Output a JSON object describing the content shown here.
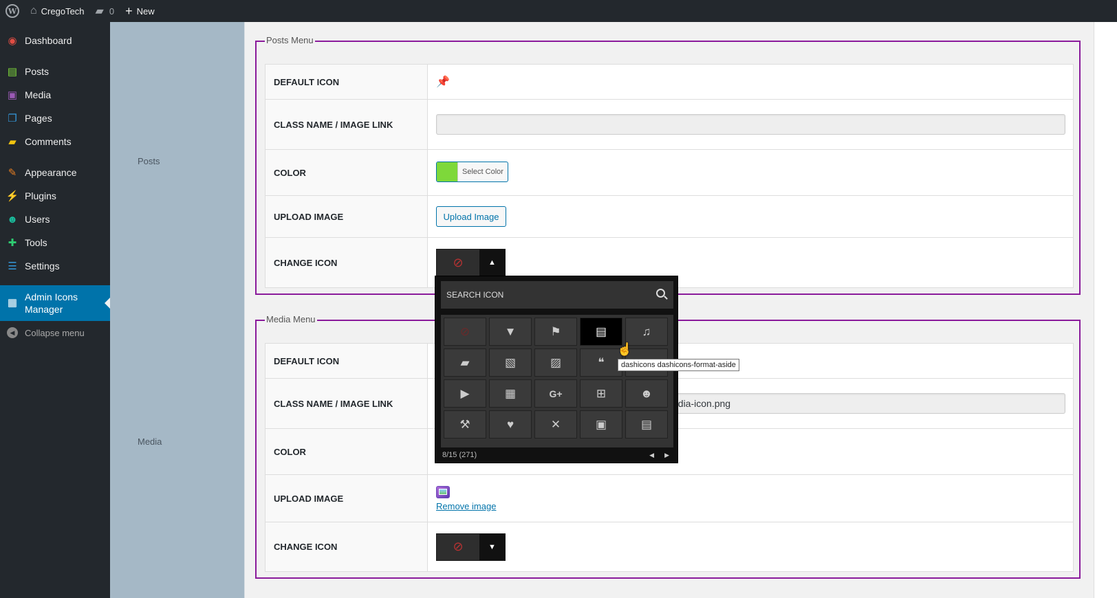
{
  "adminbar": {
    "site_name": "CregoTech",
    "comments_count": "0",
    "new_label": "New"
  },
  "sidebar": {
    "items": [
      {
        "label": "Dashboard",
        "icon": "dashboard-icon",
        "color": "#e14d43"
      },
      {
        "label": "Posts",
        "icon": "posts-icon",
        "color": "#7ed83a"
      },
      {
        "label": "Media",
        "icon": "media-icon",
        "color": "#9b59b6"
      },
      {
        "label": "Pages",
        "icon": "pages-icon",
        "color": "#3498db"
      },
      {
        "label": "Comments",
        "icon": "comments-icon",
        "color": "#f1c40f"
      },
      {
        "label": "Appearance",
        "icon": "appearance-icon",
        "color": "#e67e22"
      },
      {
        "label": "Plugins",
        "icon": "plugins-icon",
        "color": "#e67e22"
      },
      {
        "label": "Users",
        "icon": "users-icon",
        "color": "#1abc9c"
      },
      {
        "label": "Tools",
        "icon": "tools-icon",
        "color": "#2ecc71"
      },
      {
        "label": "Settings",
        "icon": "settings-icon",
        "color": "#3498db"
      },
      {
        "label": "Admin Icons Manager",
        "icon": "admin-icons-manager-icon",
        "color": "#ffffff"
      },
      {
        "label": "Collapse menu",
        "icon": "collapse-icon",
        "color": "#888888"
      }
    ]
  },
  "sections": {
    "posts": {
      "label": "Posts",
      "legend": "Posts Menu",
      "rows": {
        "default_icon": "DEFAULT ICON",
        "class_name": "CLASS NAME / IMAGE LINK",
        "color": "COLOR",
        "upload_image": "UPLOAD IMAGE",
        "change_icon": "CHANGE ICON"
      },
      "class_value": "",
      "select_color_label": "Select Color",
      "swatch_color": "#7ed83a",
      "upload_label": "Upload Image"
    },
    "media": {
      "label": "Media",
      "legend": "Media Menu",
      "rows": {
        "default_icon": "DEFAULT ICON",
        "class_name": "CLASS NAME / IMAGE LINK",
        "color": "COLOR",
        "upload_image": "UPLOAD IMAGE",
        "change_icon": "CHANGE ICON"
      },
      "class_value_visible": "edia-icon.png",
      "remove_label": "Remove image"
    }
  },
  "picker": {
    "search_placeholder": "SEARCH ICON",
    "page_info": "8/15 (271)",
    "icons": [
      "no-icon",
      "filter-icon",
      "flag-icon",
      "format-aside-icon",
      "format-audio-icon",
      "format-chat-icon",
      "format-gallery-icon",
      "format-image-icon",
      "format-quote-icon",
      "format-status-icon",
      "format-video-icon",
      "qr-code-icon",
      "google-plus-icon",
      "grid-view-icon",
      "groups-icon",
      "hammer-icon",
      "heart-icon",
      "hidden-icon",
      "id-icon",
      "id-alt-icon"
    ],
    "active_index": 3
  },
  "tooltip": "dashicons dashicons-format-aside"
}
